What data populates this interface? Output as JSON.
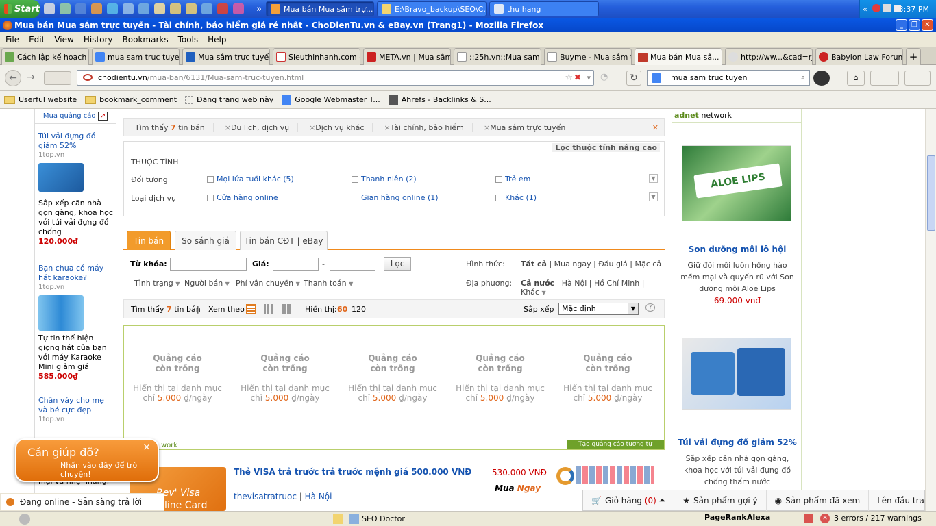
{
  "taskbar": {
    "start_label": "Start",
    "tasks": [
      {
        "label": "Mua bán Mua sắm trự...",
        "active": true
      },
      {
        "label": "E:\\Bravo_backup\\SEO\\C...",
        "active": false
      },
      {
        "label": "thu hang",
        "active": false
      }
    ],
    "overflow": "»",
    "tray_chevron": "«",
    "clock": "3:37 PM"
  },
  "window": {
    "title": "Mua bán Mua sắm trực tuyến - Tài chính, bảo hiểm giá rẻ nhất - ChoDienTu.vn & eBay.vn (Trang1) - Mozilla Firefox"
  },
  "menu": [
    "File",
    "Edit",
    "View",
    "History",
    "Bookmarks",
    "Tools",
    "Help"
  ],
  "tabs": [
    {
      "label": "Cách lập kế hoạch k...",
      "color": "#6aa84f"
    },
    {
      "label": "mua sam truc tuyen ...",
      "color": "#4285f4"
    },
    {
      "label": "Mua sắm trực tuyế...",
      "color": "#1f5fbf"
    },
    {
      "label": "Sieuthinhanh.com –...",
      "color": "#ffffff"
    },
    {
      "label": "META.vn | Mua sắm...",
      "color": "#cc2222"
    },
    {
      "label": "::25h.vn::Mua sam ...",
      "color": "#ffffff"
    },
    {
      "label": "Buyme - Mua sắm tr...",
      "color": "#ffffff"
    },
    {
      "label": "Mua bán Mua sắ...",
      "color": "#c0392b",
      "active": true
    },
    {
      "label": "http://ww...&cad=rja",
      "color": "#dddddd"
    },
    {
      "label": "Babylon Law Forums",
      "color": "#cc2222"
    }
  ],
  "new_tab": "+",
  "nav": {
    "url_domain": "chodientu.vn",
    "url_path": "/mua-ban/6131/Mua-sam-truc-tuyen.html",
    "search_value": "mua sam truc tuyen"
  },
  "bookmarks": [
    {
      "label": "Userful website",
      "type": "folder"
    },
    {
      "label": "bookmark_comment",
      "type": "folder"
    },
    {
      "label": "Đăng trang web này",
      "type": "page"
    },
    {
      "label": "Google Webmaster T...",
      "type": "google"
    },
    {
      "label": "Ahrefs - Backlinks & S...",
      "type": "page"
    }
  ],
  "left_ads": {
    "header": "Mua quảng cáo",
    "items": [
      {
        "title": "Túi vải đựng đồ giảm 52%",
        "source": "1top.vn",
        "desc": "Sắp xếp căn nhà gọn gàng, khoa học với túi vải đựng đồ chống",
        "price": "120.000₫"
      },
      {
        "title": "Bạn chưa có máy hát karaoke?",
        "source": "1top.vn",
        "desc": "Tự tin thể hiện giọng hát của bạn với máy Karaoke Mini giảm giá",
        "price": "585.000₫"
      },
      {
        "title": "Chân váy cho mẹ và bé cực đẹp",
        "source": "1top.vn",
        "desc": "mại và nhẹ nhàng,",
        "price": ""
      }
    ]
  },
  "breadcrumb": {
    "found_prefix": "Tìm thấy",
    "count": "7",
    "found_suffix": "tin bán",
    "chips": [
      "Du lịch, dịch vụ",
      "Dịch vụ khác",
      "Tài chính, bảo hiểm",
      "Mua sắm trực tuyến"
    ],
    "chip_x": "×",
    "close": "✕"
  },
  "filters": {
    "advanced": "Lọc thuộc tính nâng cao",
    "heading": "THUỘC TÍNH",
    "rows": [
      {
        "label": "Đối tượng",
        "options": [
          "Mọi lứa tuổi khác (5)",
          "Thanh niên (2)",
          "Trẻ em"
        ]
      },
      {
        "label": "Loại dịch vụ",
        "options": [
          "Cửa hàng online",
          "Gian hàng online (1)",
          "Khác (1)"
        ]
      }
    ]
  },
  "listing_tabs": [
    "Tin bán",
    "So sánh giá",
    "Tin bán CĐT | eBay"
  ],
  "search_form": {
    "keyword_label": "Từ khóa:",
    "price_label": "Giá:",
    "dash": "-",
    "filter_button": "Lọc",
    "form_label": "Hình thức:",
    "form_options": [
      "Tất cả",
      "Mua ngay",
      "Đấu giá",
      "Mặc cả"
    ],
    "dropdowns": [
      "Tình trạng",
      "Người bán",
      "Phí vận chuyển",
      "Thanh toán"
    ],
    "region_label": "Địa phương:",
    "region_options": [
      "Cả nước",
      "Hà Nội",
      "Hồ Chí Minh",
      "Khác"
    ]
  },
  "sort_row": {
    "found_prefix": "Tìm thấy",
    "count": "7",
    "found_suffix": "tin bán",
    "sep": "|",
    "view_label": "Xem theo",
    "show_label": "Hiển thị:",
    "show_options": [
      "60",
      "120"
    ],
    "sort_label": "Sắp xếp",
    "sort_value": "Mặc định"
  },
  "ad_slots": {
    "title": "Quảng cáo còn trống",
    "line1": "Hiển thị tại danh mục",
    "line2_prefix": "chỉ",
    "price": "5.000",
    "line2_suffix": "₫/ngày",
    "count": 5,
    "footer_left": "work",
    "footer_right": "Tạo quảng cáo tương tự"
  },
  "product": {
    "img_text_1": "Rev' Visa",
    "img_text_2": "line Card",
    "title": "Thẻ VISA trả trước trả trước mệnh giá 500.000 VNĐ",
    "seller": "thevisatratruoc",
    "location": "Hà Nội",
    "price": "530.000 VNĐ",
    "buy_label_1": "Mua",
    "buy_label_2": "Ngay"
  },
  "right_col": {
    "header_brand": "adnet",
    "header_suffix": "network",
    "items": [
      {
        "image_text": "ALOE LIPS",
        "title": "Son dưỡng môi lô hội",
        "desc": "Giữ đôi môi luôn hồng hào mềm mại và quyến rũ với Son dưỡng môi Aloe Lips",
        "price": "69.000 vnđ"
      },
      {
        "image_text": "",
        "title": "Túi vải đựng đồ giảm 52%",
        "desc": "Sắp xếp căn nhà gọn gàng, khoa học với túi vải đựng đồ chống thấm nước",
        "price": ""
      }
    ]
  },
  "help": {
    "title": "Cần giúp đỡ?",
    "subtitle": "Nhấn vào đây để trò chuyện!",
    "close": "×"
  },
  "online_status": "Đang online - Sẵn sàng trả lời",
  "bottom_bar": {
    "cart_label": "Giỏ hàng",
    "cart_count": "(0)",
    "suggested": "Sản phẩm gợi ý",
    "viewed": "Sản phẩm đã xem",
    "top": "Lên đầu trang"
  },
  "statusbar": {
    "seo": "SEO Doctor",
    "pagerank": "PageRank",
    "alexa": "Alexa",
    "errors": "3 errors / 217 warnings"
  },
  "colors": {
    "accent_orange": "#f08a1d",
    "link_blue": "#1553b0",
    "price_red": "#cc0000",
    "xp_blue": "#245edb"
  }
}
